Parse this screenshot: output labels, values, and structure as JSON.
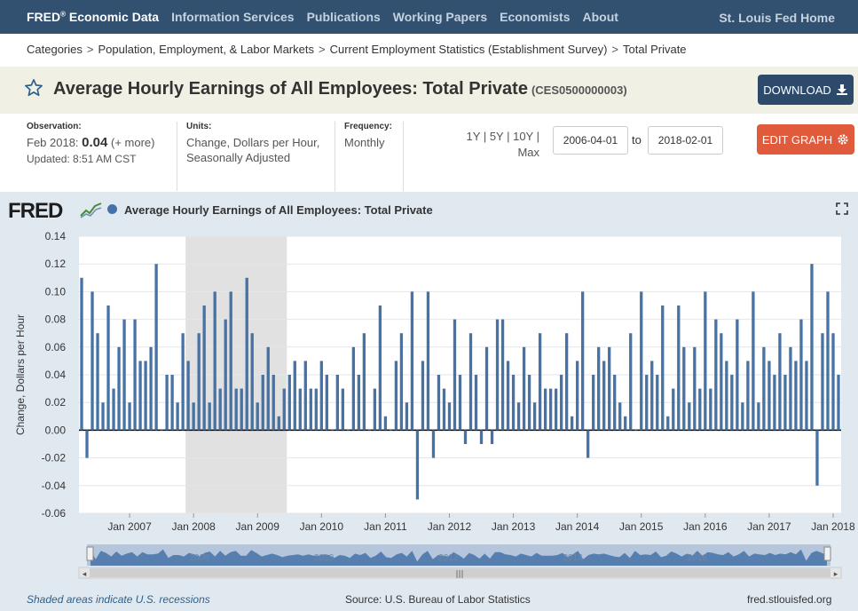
{
  "nav": {
    "brand": "FRED",
    "brand_mark": "®",
    "brand_suffix": "Economic Data",
    "links": [
      "Information Services",
      "Publications",
      "Working Papers",
      "Economists",
      "About"
    ],
    "home": "St. Louis Fed Home"
  },
  "breadcrumb": [
    "Categories",
    "Population, Employment, & Labor Markets",
    "Current Employment Statistics (Establishment Survey)",
    "Total Private"
  ],
  "breadcrumb_sep": ">",
  "series": {
    "title": "Average Hourly Earnings of All Employees: Total Private",
    "id": "(CES0500000003)"
  },
  "buttons": {
    "download": "DOWNLOAD",
    "edit": "EDIT GRAPH"
  },
  "meta": {
    "observation_label": "Observation:",
    "observation_date": "Feb 2018:",
    "observation_value": "0.04",
    "observation_more": "(+ more)",
    "updated": "Updated: 8:51 AM CST",
    "units_label": "Units:",
    "units_value": "Change, Dollars per Hour, Seasonally Adjusted",
    "frequency_label": "Frequency:",
    "frequency_value": "Monthly"
  },
  "range": {
    "links": [
      "1Y",
      "5Y",
      "10Y",
      "Max"
    ],
    "start": "2006-04-01",
    "to": "to",
    "end": "2018-02-01"
  },
  "chart_logo": "FRED",
  "footer": {
    "note": "Shaded areas indicate U.S. recessions",
    "source": "Source: U.S. Bureau of Labor Statistics",
    "url": "fred.stlouisfed.org"
  },
  "colors": {
    "nav_bg": "#32506f",
    "series": "#4572a7",
    "recession": "#e1e1e1",
    "download_bg": "#2e4a6b",
    "edit_bg": "#e05a3c",
    "title_bg": "#f0f0e4",
    "panel_bg": "#e1e9f0"
  },
  "icons": {
    "star": "star-icon",
    "download": "download-icon",
    "gear": "gear-icon",
    "fullscreen": "fullscreen-icon"
  },
  "chart_data": {
    "type": "bar",
    "title": "Average Hourly Earnings of All Employees: Total Private",
    "ylabel": "Change, Dollars per Hour",
    "xlabel": "",
    "ylim": [
      -0.06,
      0.14
    ],
    "yticks": [
      "0.14",
      "0.12",
      "0.10",
      "0.08",
      "0.06",
      "0.04",
      "0.02",
      "0.00",
      "-0.02",
      "-0.04",
      "-0.06"
    ],
    "xticks": [
      "Jan 2007",
      "Jan 2008",
      "Jan 2009",
      "Jan 2010",
      "Jan 2011",
      "Jan 2012",
      "Jan 2013",
      "Jan 2014",
      "Jan 2015",
      "Jan 2016",
      "Jan 2017",
      "Jan 2018"
    ],
    "x_start": "2006-04",
    "x_end": "2018-02",
    "recession": {
      "start": "2007-12",
      "end": "2009-06"
    },
    "navigator_labels": [
      "2008",
      "2010",
      "2012",
      "2014",
      "2016"
    ],
    "values": [
      0.11,
      -0.02,
      0.1,
      0.07,
      0.02,
      0.09,
      0.03,
      0.06,
      0.08,
      0.02,
      0.08,
      0.05,
      0.05,
      0.06,
      0.12,
      0.0,
      0.04,
      0.04,
      0.02,
      0.07,
      0.05,
      0.02,
      0.07,
      0.09,
      0.02,
      0.1,
      0.03,
      0.08,
      0.1,
      0.03,
      0.03,
      0.11,
      0.07,
      0.02,
      0.04,
      0.06,
      0.04,
      0.01,
      0.03,
      0.04,
      0.05,
      0.03,
      0.05,
      0.03,
      0.03,
      0.05,
      0.04,
      0.0,
      0.04,
      0.03,
      0.0,
      0.06,
      0.04,
      0.07,
      0.0,
      0.03,
      0.09,
      0.01,
      0.0,
      0.05,
      0.07,
      0.02,
      0.1,
      -0.05,
      0.05,
      0.1,
      -0.02,
      0.04,
      0.03,
      0.02,
      0.08,
      0.04,
      -0.01,
      0.07,
      0.04,
      -0.01,
      0.06,
      -0.01,
      0.08,
      0.08,
      0.05,
      0.04,
      0.02,
      0.06,
      0.04,
      0.02,
      0.07,
      0.03,
      0.03,
      0.03,
      0.04,
      0.07,
      0.01,
      0.05,
      0.1,
      -0.02,
      0.04,
      0.06,
      0.05,
      0.06,
      0.04,
      0.02,
      0.01,
      0.07,
      0.0,
      0.1,
      0.04,
      0.05,
      0.04,
      0.09,
      0.01,
      0.03,
      0.09,
      0.06,
      0.02,
      0.06,
      0.03,
      0.1,
      0.03,
      0.08,
      0.07,
      0.05,
      0.04,
      0.08,
      0.02,
      0.05,
      0.1,
      0.02,
      0.06,
      0.05,
      0.04,
      0.07,
      0.04,
      0.06,
      0.05,
      0.08,
      0.05,
      0.12,
      -0.04,
      0.07,
      0.1,
      0.07,
      0.04
    ]
  }
}
